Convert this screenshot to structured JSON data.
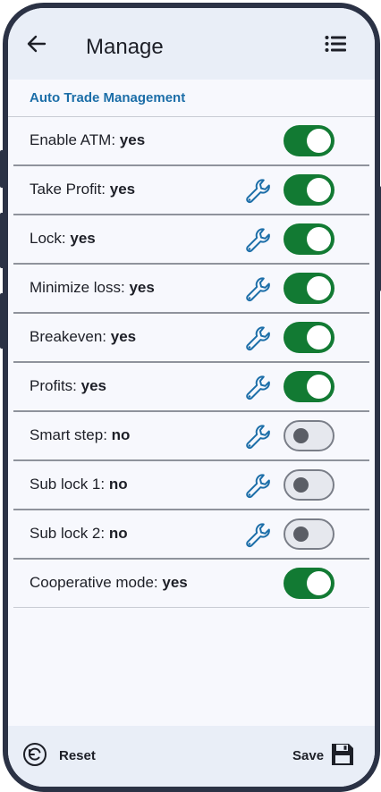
{
  "header": {
    "title": "Manage"
  },
  "section": {
    "title": "Auto Trade Management"
  },
  "rows": [
    {
      "label": "Enable ATM: ",
      "value": "yes",
      "wrench": false,
      "on": true
    },
    {
      "label": "Take Profit: ",
      "value": "yes",
      "wrench": true,
      "on": true
    },
    {
      "label": "Lock: ",
      "value": "yes",
      "wrench": true,
      "on": true
    },
    {
      "label": "Minimize loss: ",
      "value": "yes",
      "wrench": true,
      "on": true
    },
    {
      "label": "Breakeven: ",
      "value": "yes",
      "wrench": true,
      "on": true
    },
    {
      "label": "Profits: ",
      "value": "yes",
      "wrench": true,
      "on": true
    },
    {
      "label": "Smart step: ",
      "value": "no",
      "wrench": true,
      "on": false
    },
    {
      "label": "Sub lock 1: ",
      "value": "no",
      "wrench": true,
      "on": false
    },
    {
      "label": "Sub lock 2: ",
      "value": "no",
      "wrench": true,
      "on": false
    },
    {
      "label": "Cooperative mode: ",
      "value": "yes",
      "wrench": false,
      "on": true
    }
  ],
  "footer": {
    "reset_label": "Reset",
    "save_label": "Save"
  },
  "colors": {
    "accent": "#1c6ea8",
    "toggle_on": "#127a33",
    "wrench": "#1c6ea8"
  },
  "icons": {
    "back": "arrow-left-icon",
    "menu": "list-icon",
    "setting": "wrench-icon",
    "reset": "reset-icon",
    "save": "floppy-disk-icon"
  }
}
